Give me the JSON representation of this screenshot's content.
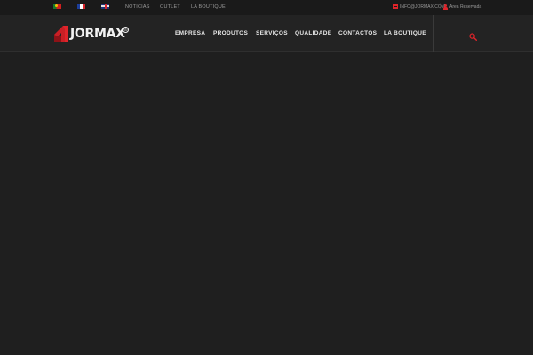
{
  "topbar": {
    "languages": [
      {
        "code": "pt",
        "icon": "portugal-flag-icon"
      },
      {
        "code": "fr",
        "icon": "france-flag-icon"
      },
      {
        "code": "en",
        "icon": "uk-flag-icon"
      }
    ],
    "links": [
      "NOTÍCIAS",
      "OUTLET",
      "LA BOUTIQUE"
    ],
    "email": "INFO@JORMAX.COM",
    "email_icon": "envelope-icon",
    "separator": "|",
    "account_label": "Área Reservada",
    "account_icon": "user-icon"
  },
  "header": {
    "logo_text": "JORMAX",
    "logo_mark": "®",
    "nav": [
      "EMPRESA",
      "PRODUTOS",
      "SERVIÇOS",
      "QUALIDADE",
      "CONTACTOS",
      "LA BOUTIQUE"
    ],
    "search_icon": "search-icon"
  },
  "colors": {
    "accent": "#e0242a",
    "background": "#1f1f1f",
    "header": "#232323",
    "topbar": "#1a1a1a"
  }
}
